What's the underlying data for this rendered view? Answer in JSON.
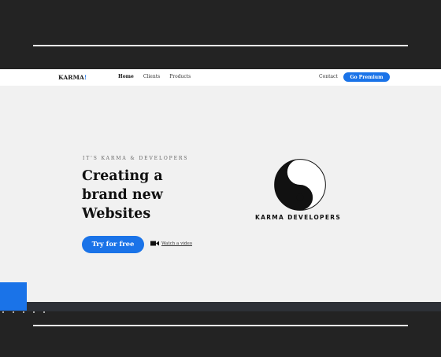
{
  "nav": {
    "brand": "KARMA",
    "brand_mark": "!",
    "links": [
      "Home",
      "Clients",
      "Products"
    ],
    "contact": "Contact",
    "premium": "Go Premium"
  },
  "hero": {
    "eyebrow": "IT'S KARMA & DEVELOPERS",
    "headline": [
      "Creating a",
      "brand new",
      "Websites"
    ],
    "cta": "Try for free",
    "video_link": "Watch a video"
  },
  "logo": {
    "text": "KARMA DEVELOPERS",
    "icon": "yin-yang-icon"
  },
  "colors": {
    "accent": "#1a73e8",
    "frame": "#232323",
    "page": "#f1f1f1"
  }
}
